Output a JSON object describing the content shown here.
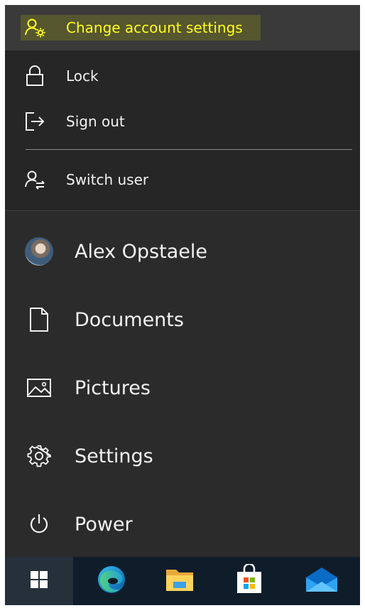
{
  "account_menu": {
    "change_settings": "Change account settings",
    "lock": "Lock",
    "sign_out": "Sign out",
    "switch_user": "Switch user"
  },
  "rail": {
    "user_name": "Alex Opstaele",
    "documents": "Documents",
    "pictures": "Pictures",
    "settings": "Settings",
    "power": "Power"
  },
  "taskbar": {
    "apps": [
      "start-icon",
      "edge-icon",
      "file-explorer-icon",
      "microsoft-store-icon",
      "mail-icon"
    ]
  },
  "colors": {
    "highlight_text": "#ffff1e",
    "menu_bg": "#262626",
    "rail_bg": "#2b2b2b",
    "taskbar_bg": "#0f1d2a"
  }
}
